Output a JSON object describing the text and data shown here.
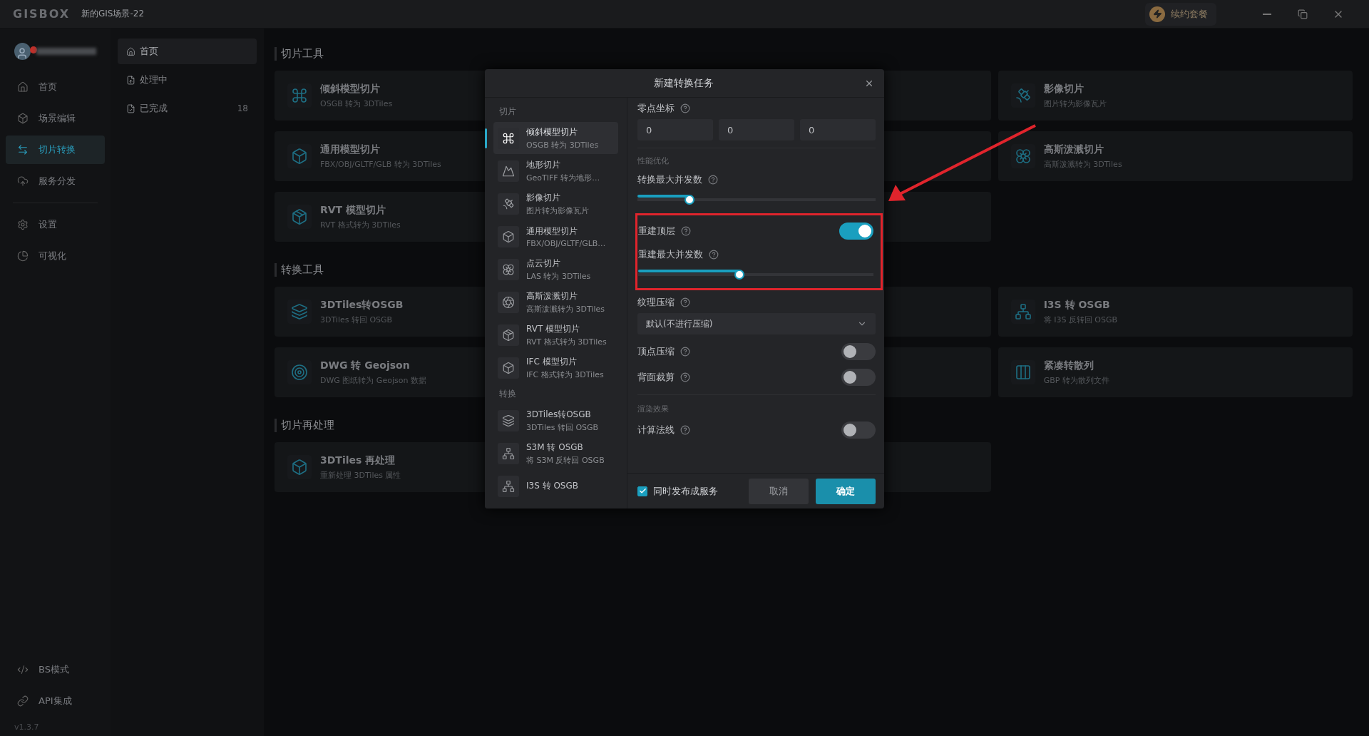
{
  "app": {
    "logo": "GISBOX",
    "title": "新的GIS场景-22",
    "renew_button": "续约套餐"
  },
  "nav": {
    "groups": [
      [
        {
          "label": "首页",
          "selected": false
        },
        {
          "label": "场景编辑",
          "selected": false
        },
        {
          "label": "切片转换",
          "selected": true
        },
        {
          "label": "服务分发",
          "selected": false
        }
      ],
      [
        {
          "label": "设置",
          "selected": false
        },
        {
          "label": "可视化",
          "selected": false
        }
      ]
    ],
    "bottom": [
      {
        "label": "BS模式"
      },
      {
        "label": "API集成"
      }
    ],
    "version": "v1.3.7"
  },
  "subnav": [
    {
      "label": "首页",
      "selected": true
    },
    {
      "label": "处理中",
      "selected": false
    },
    {
      "label": "已完成",
      "selected": false,
      "count": "18"
    }
  ],
  "sections": [
    {
      "title": "切片工具",
      "cards": [
        {
          "kind": "tool",
          "title": "倾斜模型切片",
          "subtitle": "OSGB 转为 3DTiles"
        },
        {
          "kind": "covered"
        },
        {
          "kind": "tool",
          "title": "影像切片",
          "subtitle": "图片转为影像瓦片"
        },
        {
          "kind": "tool",
          "title": "通用模型切片",
          "subtitle": "FBX/OBJ/GLTF/GLB 转为 3DTiles"
        },
        {
          "kind": "covered"
        },
        {
          "kind": "tool",
          "title": "高斯泼溅切片",
          "subtitle": "高斯泼溅转为 3DTiles"
        },
        {
          "kind": "tool",
          "title": "RVT 模型切片",
          "subtitle": "RVT 格式转为 3DTiles"
        },
        {
          "kind": "covered"
        }
      ]
    },
    {
      "title": "转换工具",
      "cards": [
        {
          "kind": "tool",
          "title": "3DTiles转OSGB",
          "subtitle": "3DTiles 转回 OSGB"
        },
        {
          "kind": "covered"
        },
        {
          "kind": "tool",
          "title": "I3S 转 OSGB",
          "subtitle": "将 I3S 反转回 OSGB"
        },
        {
          "kind": "tool",
          "title": "DWG 转 Geojson",
          "subtitle": "DWG 图纸转为 Geojson 数据"
        },
        {
          "kind": "covered"
        },
        {
          "kind": "tool",
          "title": "紧凑转散列",
          "subtitle": "GBP 转为散列文件"
        }
      ]
    },
    {
      "title": "切片再处理",
      "cards": [
        {
          "kind": "tool",
          "title": "3DTiles 再处理",
          "subtitle": "重新处理 3DTiles 属性"
        },
        {
          "kind": "covered"
        }
      ]
    }
  ],
  "dialog": {
    "title": "新建转换任务",
    "list": [
      {
        "label": "切片",
        "items": [
          {
            "title": "倾斜模型切片",
            "subtitle": "OSGB 转为 3DTiles",
            "selected": true
          },
          {
            "title": "地形切片",
            "subtitle": "GeoTIFF 转为地形…",
            "selected": false
          },
          {
            "title": "影像切片",
            "subtitle": "图片转为影像瓦片",
            "selected": false
          },
          {
            "title": "通用模型切片",
            "subtitle": "FBX/OBJ/GLTF/GLB…",
            "selected": false
          },
          {
            "title": "点云切片",
            "subtitle": "LAS 转为 3DTiles",
            "selected": false
          },
          {
            "title": "高斯泼溅切片",
            "subtitle": "高斯泼溅转为 3DTiles",
            "selected": false
          },
          {
            "title": "RVT 模型切片",
            "subtitle": "RVT 格式转为 3DTiles",
            "selected": false
          },
          {
            "title": "IFC 模型切片",
            "subtitle": "IFC 格式转为 3DTiles",
            "selected": false
          }
        ]
      },
      {
        "label": "转换",
        "items": [
          {
            "title": "3DTiles转OSGB",
            "subtitle": "3DTiles 转回 OSGB",
            "selected": false
          },
          {
            "title": "S3M 转 OSGB",
            "subtitle": "将 S3M 反转回 OSGB",
            "selected": false
          },
          {
            "title": "I3S 转 OSGB",
            "selected": false
          }
        ]
      }
    ],
    "fields": [
      {
        "kind": "coords",
        "label": "零点坐标",
        "values": [
          "0",
          "0",
          "0"
        ]
      },
      {
        "kind": "section",
        "label": "性能优化"
      },
      {
        "kind": "slider",
        "label": "转换最大并发数",
        "level": 0.22
      },
      {
        "kind": "switch",
        "label": "重建顶层",
        "on": true,
        "highlighted": true
      },
      {
        "kind": "slider",
        "label": "重建最大并发数",
        "level": 0.43,
        "highlighted": true
      },
      {
        "kind": "select",
        "label": "纹理压缩",
        "value": "默认(不进行压缩)"
      },
      {
        "kind": "switch",
        "label": "顶点压缩",
        "on": false
      },
      {
        "kind": "switch",
        "label": "背面裁剪",
        "on": false
      },
      {
        "kind": "section",
        "label": "渲染效果"
      },
      {
        "kind": "switch",
        "label": "计算法线",
        "on": false
      }
    ],
    "publish": {
      "label": "同时发布成服务",
      "checked": true
    },
    "cancel": "取消",
    "confirm": "确定"
  }
}
